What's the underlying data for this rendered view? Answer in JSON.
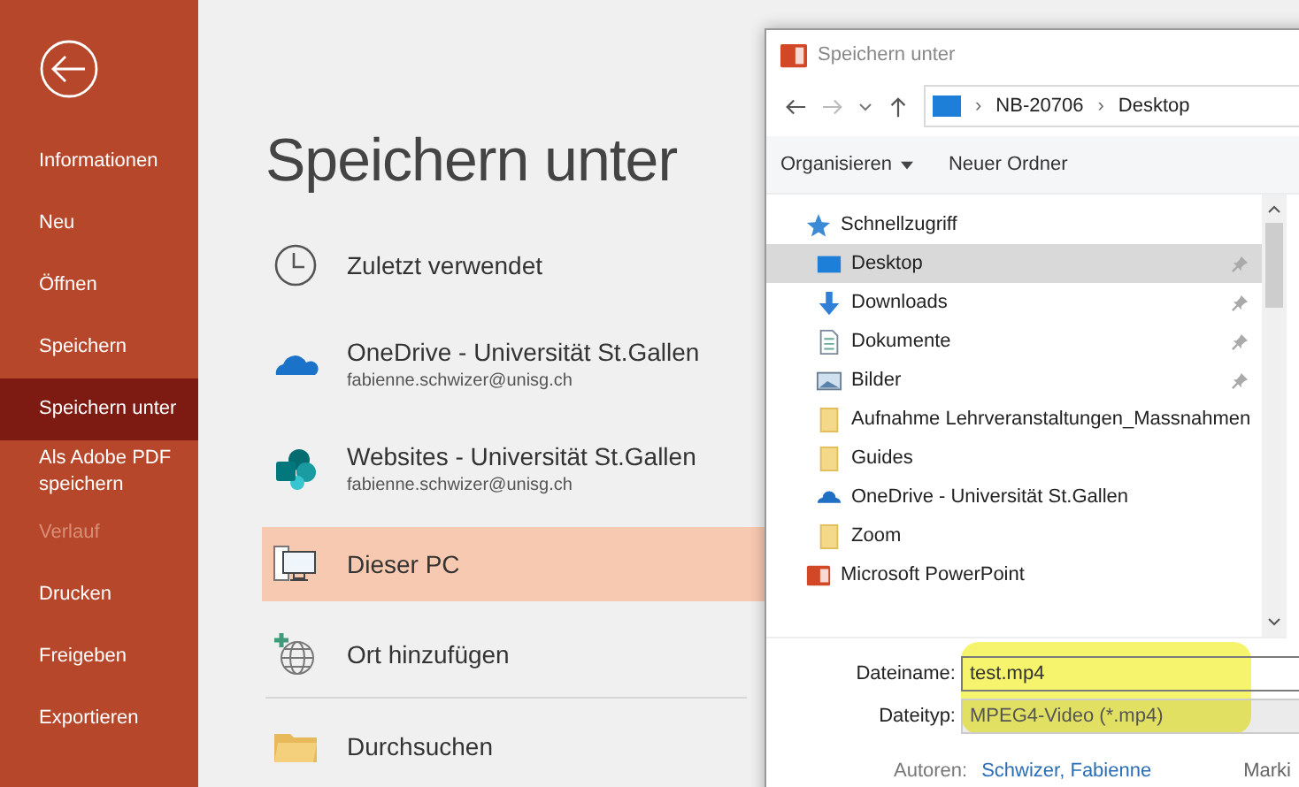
{
  "sidebar": {
    "items": [
      {
        "label": "Informationen",
        "selected": false,
        "disabled": false
      },
      {
        "label": "Neu",
        "selected": false,
        "disabled": false
      },
      {
        "label": "Öffnen",
        "selected": false,
        "disabled": false
      },
      {
        "label": "Speichern",
        "selected": false,
        "disabled": false
      },
      {
        "label": "Speichern unter",
        "selected": true,
        "disabled": false
      },
      {
        "label": "Als Adobe PDF speichern",
        "selected": false,
        "disabled": false
      },
      {
        "label": "Verlauf",
        "selected": false,
        "disabled": true
      },
      {
        "label": "Drucken",
        "selected": false,
        "disabled": false
      },
      {
        "label": "Freigeben",
        "selected": false,
        "disabled": false
      },
      {
        "label": "Exportieren",
        "selected": false,
        "disabled": false
      }
    ]
  },
  "page_title": "Speichern unter",
  "locations": [
    {
      "kind": "recent",
      "label": "Zuletzt verwendet",
      "selected": false
    },
    {
      "kind": "onedrive",
      "label": "OneDrive - Universität St.Gallen",
      "account": "fabienne.schwizer@unisg.ch",
      "selected": false
    },
    {
      "kind": "sharepoint",
      "label": "Websites - Universität St.Gallen",
      "account": "fabienne.schwizer@unisg.ch",
      "selected": false
    },
    {
      "kind": "pc",
      "label": "Dieser PC",
      "selected": true
    },
    {
      "kind": "add",
      "label": "Ort hinzufügen",
      "selected": false
    },
    {
      "kind": "browse",
      "label": "Durchsuchen",
      "selected": false
    }
  ],
  "dialog": {
    "title": "Speichern unter",
    "breadcrumb": [
      {
        "sep": "›",
        "label": "NB-20706"
      },
      {
        "sep": "›",
        "label": "Desktop"
      }
    ],
    "toolbar": [
      "Organisieren",
      "Neuer Ordner"
    ],
    "nav": [
      {
        "kind": "star",
        "label": "Schnellzugriff",
        "selected": false,
        "children": [
          {
            "kind": "desktop",
            "label": "Desktop",
            "selected": true,
            "pinned": true
          },
          {
            "kind": "download",
            "label": "Downloads",
            "selected": false,
            "pinned": true
          },
          {
            "kind": "document",
            "label": "Dokumente",
            "selected": false,
            "pinned": true
          },
          {
            "kind": "image",
            "label": "Bilder",
            "selected": false,
            "pinned": true
          },
          {
            "kind": "folder",
            "label": "Aufnahme Lehrveranstaltungen_Massnahmen",
            "selected": false,
            "pinned": false
          },
          {
            "kind": "folder",
            "label": "Guides",
            "selected": false,
            "pinned": false
          },
          {
            "kind": "cloud",
            "label": "OneDrive - Universität St.Gallen",
            "selected": false,
            "pinned": false
          },
          {
            "kind": "folder",
            "label": "Zoom",
            "selected": false,
            "pinned": false
          }
        ]
      },
      {
        "kind": "app",
        "label": "Microsoft PowerPoint",
        "selected": false
      }
    ],
    "filename": {
      "label": "Dateiname:",
      "value": "test.mp4"
    },
    "filetype": {
      "label": "Dateityp:",
      "value": "MPEG4-Video (*.mp4)"
    },
    "authors": {
      "label": "Autoren:",
      "value": "Schwizer, Fabienne"
    },
    "cut_label": "Marki",
    "highlighted": true
  }
}
